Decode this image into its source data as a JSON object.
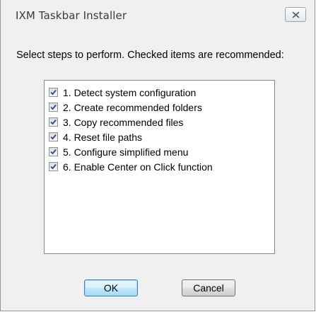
{
  "window": {
    "title": "IXM Taskbar Installer",
    "close_icon": "close-x-icon"
  },
  "instructions": "Select steps to perform.  Checked items are recommended:",
  "steps": [
    {
      "label": "1. Detect system configuration",
      "checked": true
    },
    {
      "label": "2. Create recommended folders",
      "checked": true
    },
    {
      "label": "3. Copy recommended files",
      "checked": true
    },
    {
      "label": "4. Reset file paths",
      "checked": true
    },
    {
      "label": "5. Configure simplified menu",
      "checked": true
    },
    {
      "label": "6. Enable Center on Click function",
      "checked": true
    }
  ],
  "buttons": {
    "ok": "OK",
    "cancel": "Cancel"
  },
  "colors": {
    "dialog_background": "#f0f0f0",
    "checkmark": "#2b4a7e",
    "default_button_border": "#3c7fb1"
  }
}
